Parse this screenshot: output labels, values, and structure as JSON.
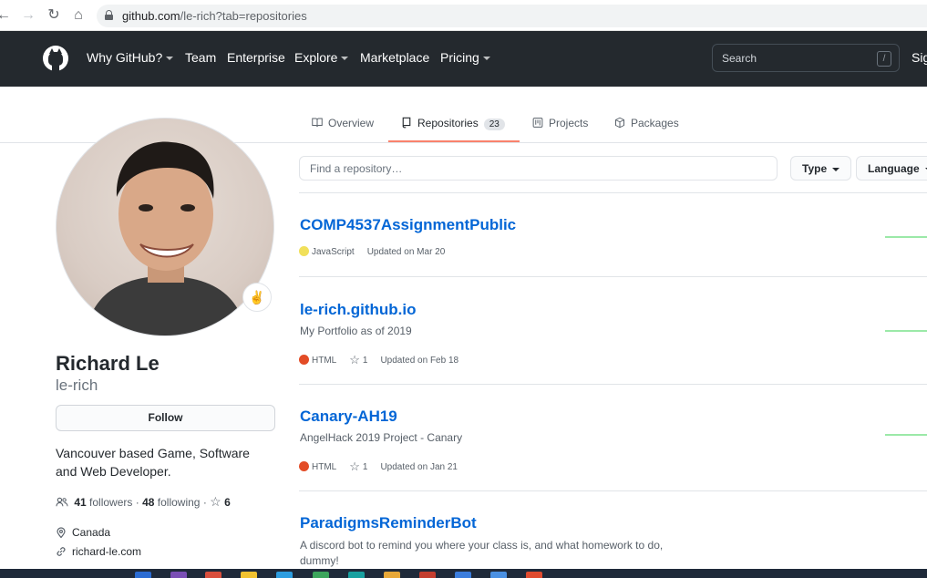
{
  "browser": {
    "url_host": "github.com",
    "url_path": "/le-rich?tab=repositories"
  },
  "header": {
    "nav": [
      "Why GitHub?",
      "Team",
      "Enterprise",
      "Explore",
      "Marketplace",
      "Pricing"
    ],
    "search_placeholder": "Search",
    "search_shortcut": "/",
    "sign_in": "Sig"
  },
  "tabs": [
    {
      "label": "Overview",
      "icon": "book-icon"
    },
    {
      "label": "Repositories",
      "icon": "repo-icon",
      "count": "23",
      "selected": true
    },
    {
      "label": "Projects",
      "icon": "project-icon"
    },
    {
      "label": "Packages",
      "icon": "package-icon"
    }
  ],
  "profile": {
    "name": "Richard Le",
    "username": "le-rich",
    "follow_label": "Follow",
    "status_emoji": "✌",
    "bio": "Vancouver based Game, Software and Web Developer.",
    "followers_count": "41",
    "followers_label": "followers",
    "following_count": "48",
    "following_label": "following",
    "stars_count": "6",
    "location": "Canada",
    "website": "richard-le.com"
  },
  "repo_filter": {
    "placeholder": "Find a repository…",
    "type_label": "Type",
    "language_label": "Language"
  },
  "repos": [
    {
      "name": "COMP4537AssignmentPublic",
      "description": "",
      "language": "JavaScript",
      "language_color": "#f1e05a",
      "stars": "",
      "updated": "Updated on Mar 20"
    },
    {
      "name": "le-rich.github.io",
      "description": "My Portfolio as of 2019",
      "language": "HTML",
      "language_color": "#e34c26",
      "stars": "1",
      "updated": "Updated on Feb 18"
    },
    {
      "name": "Canary-AH19",
      "description": "AngelHack 2019 Project - Canary",
      "language": "HTML",
      "language_color": "#e34c26",
      "stars": "1",
      "updated": "Updated on Jan 21"
    },
    {
      "name": "ParadigmsReminderBot",
      "description": "A discord bot to remind you where your class is, and what homework to do, dummy!",
      "language": "",
      "language_color": "",
      "stars": "",
      "updated": ""
    }
  ],
  "colors": {
    "header_bg": "#24292e",
    "link": "#0366d6",
    "tab_underline": "#f9826c"
  }
}
